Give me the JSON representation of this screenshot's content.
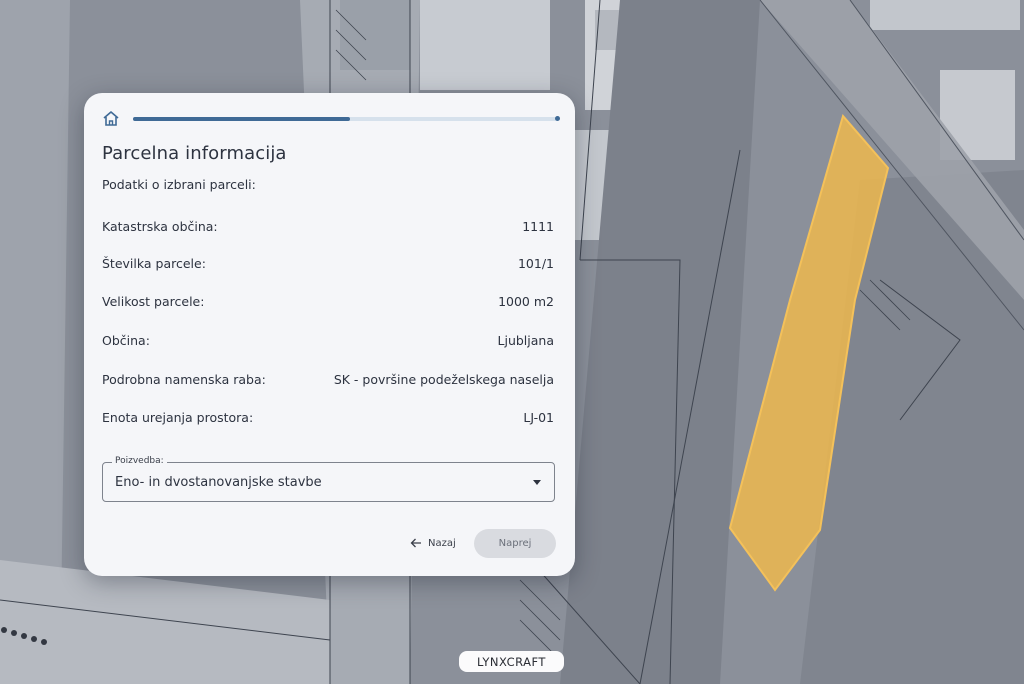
{
  "map": {
    "parcel_color": "#f2b94a"
  },
  "panel": {
    "home_icon": "home-icon",
    "progress": 0.51,
    "title": "Parcelna informacija",
    "subtitle": "Podatki o izbrani parceli:",
    "rows": [
      {
        "label": "Katastrska občina:",
        "value": "1111"
      },
      {
        "label": "Številka parcele:",
        "value": "101/1"
      },
      {
        "label": "Velikost parcele:",
        "value": "1000 m2"
      },
      {
        "label": "Občina:",
        "value": "Ljubljana"
      },
      {
        "label": "Podrobna namenska raba:",
        "value": "SK - površine podeželskega naselja"
      },
      {
        "label": "Enota urejanja prostora:",
        "value": "LJ-01"
      }
    ],
    "select": {
      "label": "Poizvedba:",
      "value": "Eno- in dvostanovanjske stavbe"
    },
    "back_label": "Nazaj",
    "next_label": "Naprej"
  },
  "brand": "LYNXCRAFT",
  "colors": {
    "accent": "#3f6a96",
    "progress_track": "#d6e1ec"
  }
}
